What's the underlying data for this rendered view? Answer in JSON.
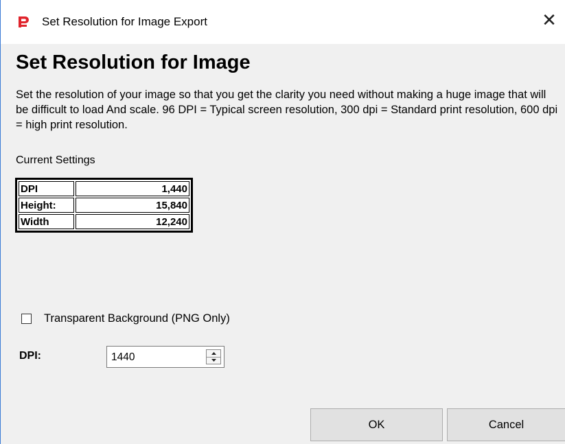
{
  "window": {
    "title": "Set Resolution for Image Export",
    "close_glyph": "✕",
    "icon": "app-logo-icon",
    "accent": "#e0242c"
  },
  "main": {
    "heading": "Set Resolution for Image",
    "description": "Set the resolution of your image so that you get the clarity you need without making a huge image that will be difficult to load And scale. 96 DPI = Typical screen resolution, 300 dpi = Standard print resolution, 600 dpi = high print resolution.",
    "current_settings_label": "Current Settings",
    "settings": [
      {
        "key": "DPI",
        "value": "1,440"
      },
      {
        "key": "Height:",
        "value": "15,840"
      },
      {
        "key": "Width",
        "value": "12,240"
      }
    ],
    "transparent_label": "Transparent Background (PNG Only)",
    "transparent_checked": false,
    "dpi_label": "DPI:",
    "dpi_value": "1440"
  },
  "footer": {
    "ok_label": "OK",
    "cancel_label": "Cancel"
  }
}
